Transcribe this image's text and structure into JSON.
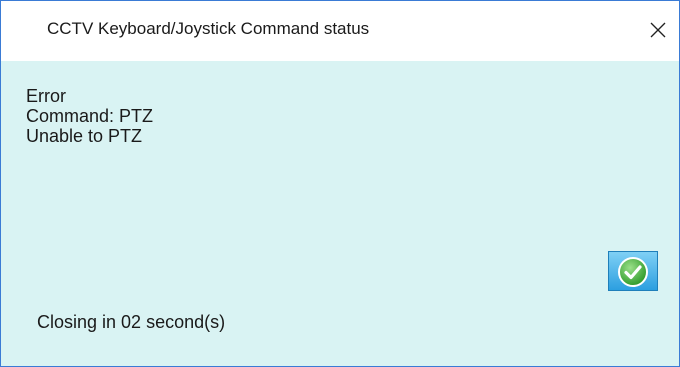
{
  "window": {
    "title": "CCTV Keyboard/Joystick Command status"
  },
  "message": {
    "line1": "Error",
    "line2": "Command: PTZ",
    "line3": "Unable to PTZ"
  },
  "countdown": {
    "text": "Closing in 02 second(s)"
  },
  "icons": {
    "close": "close-icon",
    "ok": "checkmark-icon"
  },
  "colors": {
    "content_background": "#d9f3f3",
    "window_border": "#3a7bd5",
    "ok_button": "#2c9fe0",
    "check_green": "#3fae3a"
  }
}
